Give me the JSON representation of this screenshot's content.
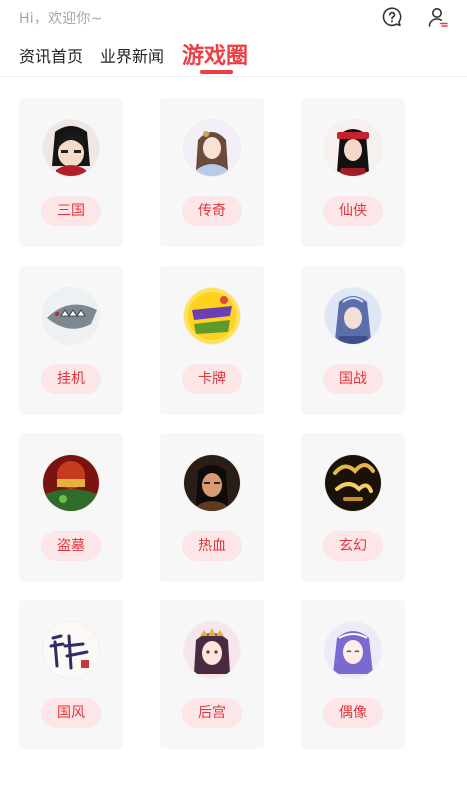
{
  "header": {
    "greeting": "Hi，欢迎你~"
  },
  "tabs": [
    {
      "label": "资讯首页"
    },
    {
      "label": "业界新闻"
    },
    {
      "label": "游戏圈"
    }
  ],
  "categories": [
    {
      "label": "三国",
      "icon": "sanguo-avatar-icon"
    },
    {
      "label": "传奇",
      "icon": "chuanqi-avatar-icon"
    },
    {
      "label": "仙侠",
      "icon": "xianxia-avatar-icon"
    },
    {
      "label": "挂机",
      "icon": "guaji-avatar-icon"
    },
    {
      "label": "卡牌",
      "icon": "kapai-avatar-icon"
    },
    {
      "label": "国战",
      "icon": "guozhan-avatar-icon"
    },
    {
      "label": "盗墓",
      "icon": "daomu-avatar-icon"
    },
    {
      "label": "热血",
      "icon": "rexue-avatar-icon"
    },
    {
      "label": "玄幻",
      "icon": "xuanhuan-avatar-icon"
    },
    {
      "label": "国风",
      "icon": "guofeng-avatar-icon"
    },
    {
      "label": "后宫",
      "icon": "hougong-avatar-icon"
    },
    {
      "label": "偶像",
      "icon": "ouxiang-avatar-icon"
    }
  ],
  "colors": {
    "accent": "#ec3f45",
    "pill_bg": "#fde6e7",
    "card_bg": "#f7f7f8"
  }
}
